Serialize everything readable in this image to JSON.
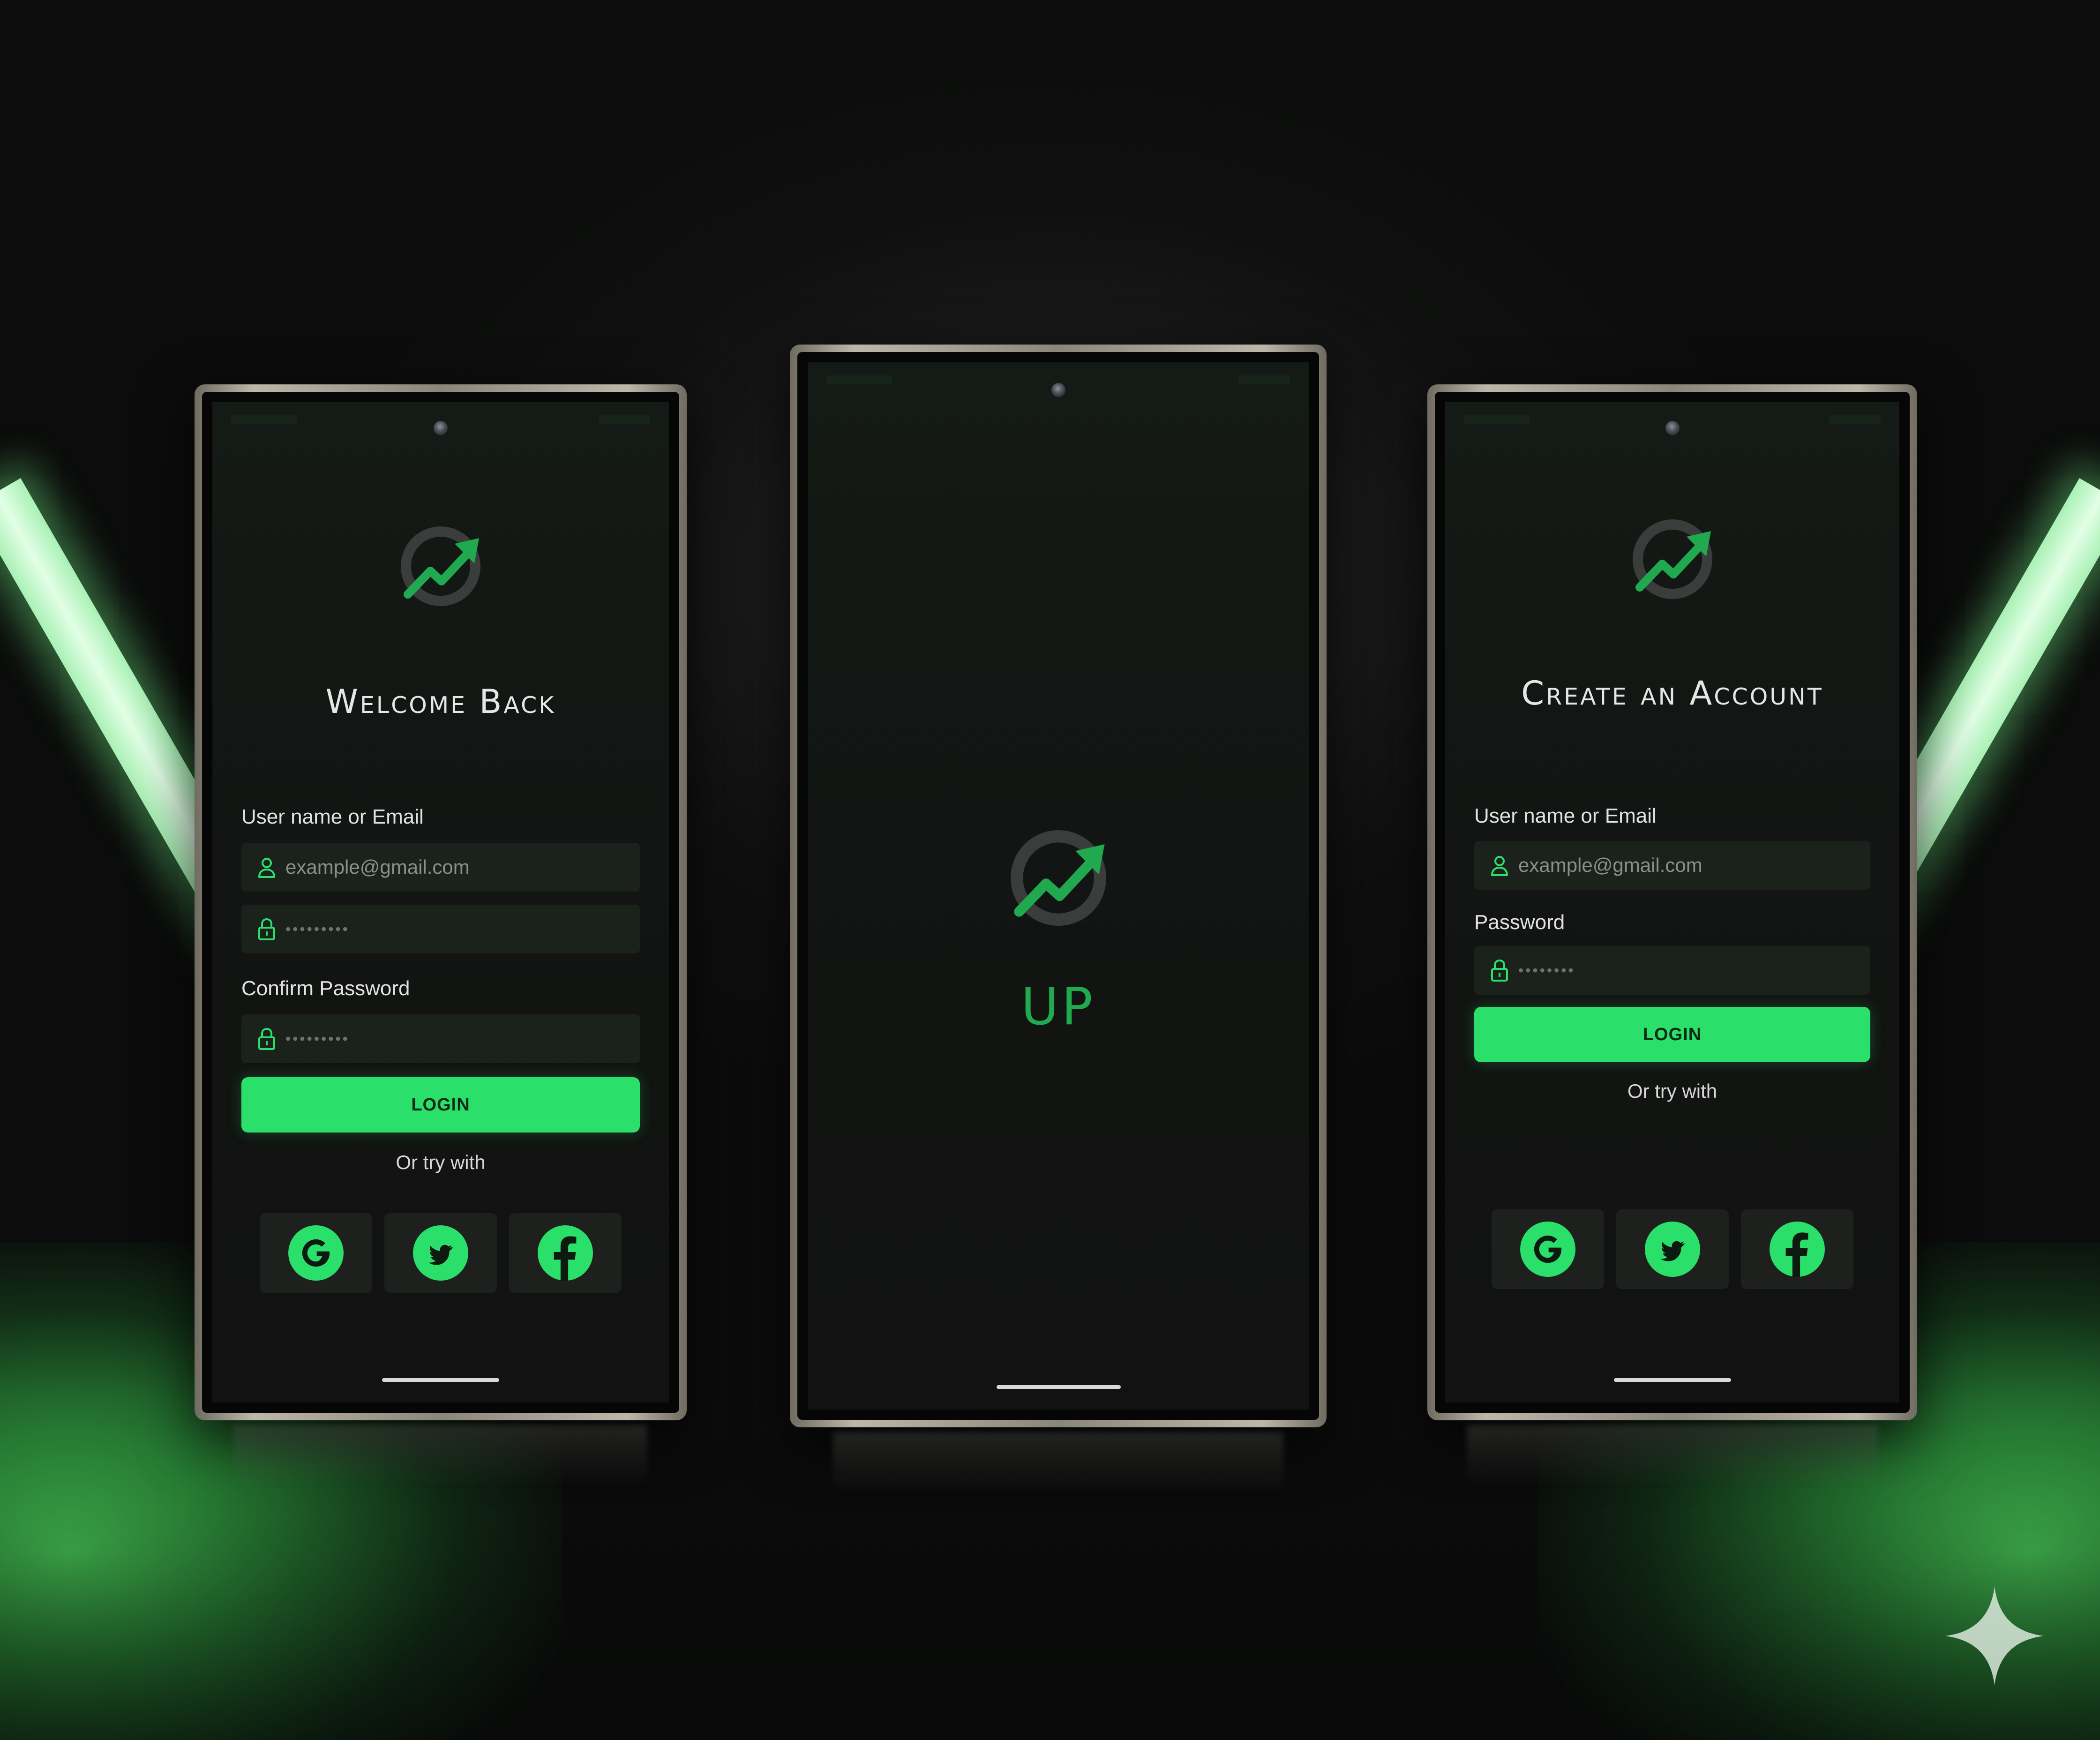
{
  "colors": {
    "accent": "#2be06a",
    "logo_green": "#21a950",
    "logo_ring": "#3a3d3b",
    "screen_bg": "#121513",
    "social_btn_bg": "#1e201e"
  },
  "icons": {
    "logo": "trending-up-arrow-ring-icon",
    "user_field": "user-icon",
    "password_field": "lock-icon",
    "google": "google-icon",
    "twitter": "twitter-bird-icon",
    "facebook": "facebook-icon",
    "sparkle": "sparkle-icon"
  },
  "login_screen": {
    "title": "Welcome Back",
    "username_label": "User name or Email",
    "username_value": "example@gmail.com",
    "password_value": "•••••••••",
    "confirm_label": "Confirm Password",
    "confirm_value": "•••••••••",
    "login_button": "LOGIN",
    "or_text": "Or try with"
  },
  "splash_screen": {
    "title": "UP"
  },
  "signup_screen": {
    "title": "Create an Account",
    "username_label": "User name or Email",
    "username_value": "example@gmail.com",
    "password_label": "Password",
    "password_value": "••••••••",
    "login_button": "LOGIN",
    "or_text": "Or try with"
  }
}
